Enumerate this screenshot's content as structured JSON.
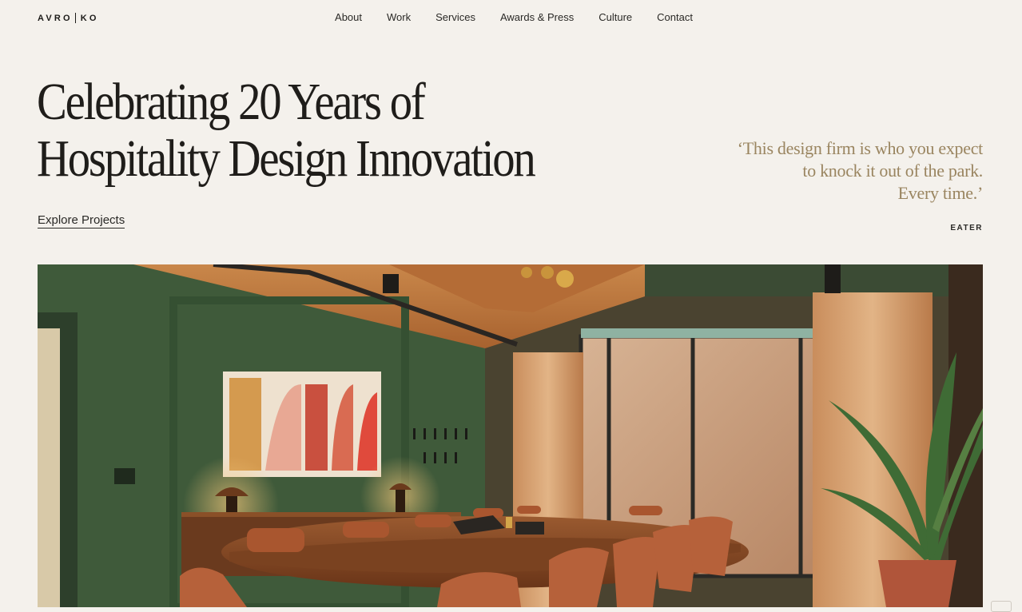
{
  "header": {
    "logo_left": "AVRO",
    "logo_right": "KO",
    "nav": [
      {
        "label": "About"
      },
      {
        "label": "Work"
      },
      {
        "label": "Services"
      },
      {
        "label": "Awards & Press"
      },
      {
        "label": "Culture"
      },
      {
        "label": "Contact"
      }
    ]
  },
  "hero": {
    "title_line1": "Celebrating 20 Years of",
    "title_line2": "Hospitality Design Innovation",
    "cta_label": "Explore Projects"
  },
  "quote": {
    "line1": "‘This design firm is who you expect",
    "line2": "to knock it out of the park.",
    "line3": "Every time.’",
    "source": "EATER"
  },
  "colors": {
    "background": "#f4f1ec",
    "text": "#1c1b19",
    "quote": "#9a8560",
    "wall_green": "#3f5a3a",
    "wood": "#8a4f2c"
  }
}
